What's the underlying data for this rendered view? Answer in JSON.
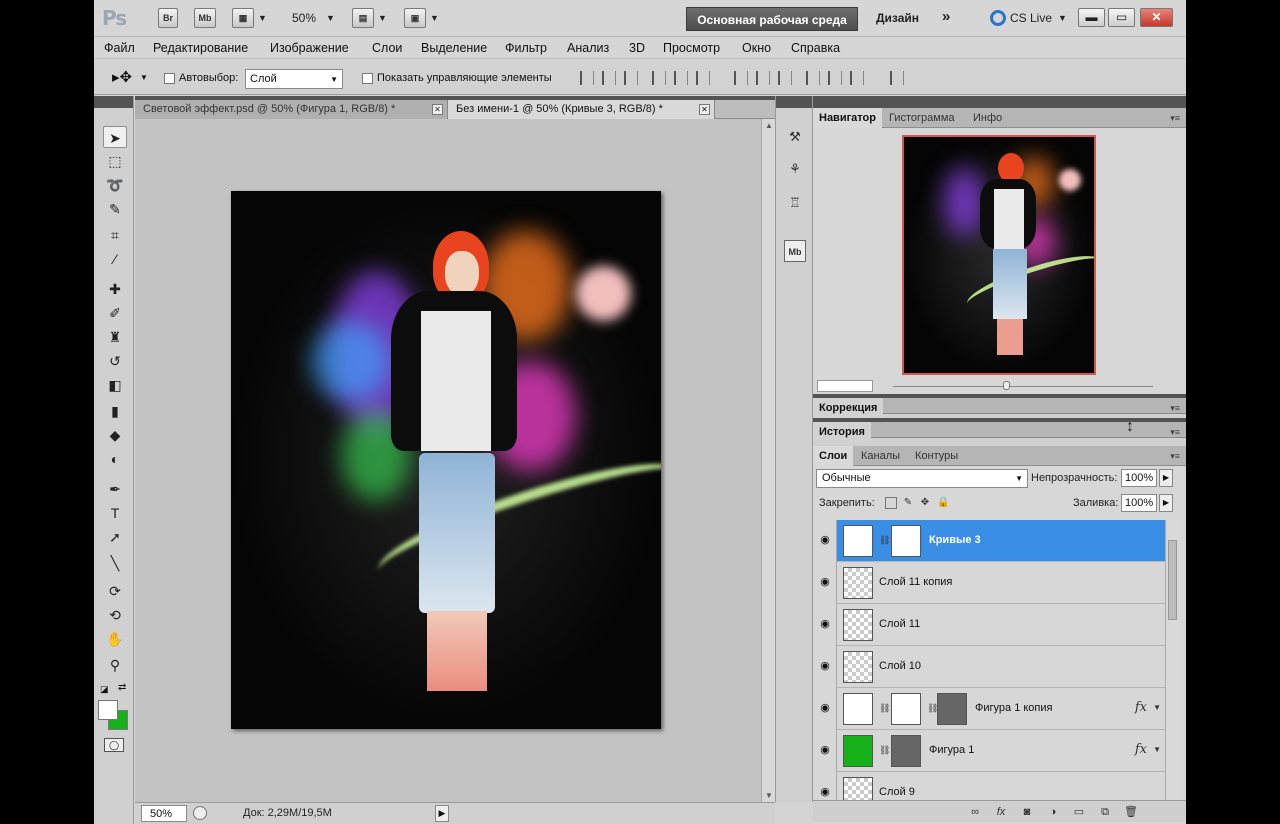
{
  "app": {
    "logo": "Ps",
    "title_icons": [
      "Br",
      "Mb"
    ],
    "zoom_level": "50%",
    "workspace_active": "Основная рабочая среда",
    "workspace_other": "Дизайн",
    "workspace_more": "»",
    "cs_live": "CS Live"
  },
  "menu": [
    "Файл",
    "Редактирование",
    "Изображение",
    "Слои",
    "Выделение",
    "Фильтр",
    "Анализ",
    "3D",
    "Просмотр",
    "Окно",
    "Справка"
  ],
  "options": {
    "autoselect_label": "Автовыбор:",
    "autoselect_value": "Слой",
    "show_controls_label": "Показать управляющие элементы"
  },
  "document_tabs": [
    {
      "label": "Световой эффект.psd @ 50% (Фигура 1, RGB/8) *",
      "active": false
    },
    {
      "label": "Без имени-1 @ 50% (Кривые 3, RGB/8) *",
      "active": true
    }
  ],
  "status": {
    "zoom": "50%",
    "doc_info": "Док: 2,29M/19,5M"
  },
  "navigator_panel": {
    "tabs": [
      "Навигатор",
      "Гистограмма",
      "Инфо"
    ]
  },
  "correction_panel": {
    "title": "Коррекция"
  },
  "history_panel": {
    "title": "История"
  },
  "layers_panel": {
    "tabs": [
      "Слои",
      "Каналы",
      "Контуры"
    ],
    "blend_mode": "Обычные",
    "opacity_label": "Непрозрачность:",
    "opacity_value": "100%",
    "lock_label": "Закрепить:",
    "fill_label": "Заливка:",
    "fill_value": "100%",
    "layers": [
      {
        "name": "Кривые 3",
        "selected": true,
        "kind": "adjustment"
      },
      {
        "name": "Слой 11 копия",
        "selected": false,
        "kind": "transparent"
      },
      {
        "name": "Слой 11",
        "selected": false,
        "kind": "transparent"
      },
      {
        "name": "Слой 10",
        "selected": false,
        "kind": "transparent"
      },
      {
        "name": "Фигура 1 копия",
        "selected": false,
        "kind": "shape-white",
        "fx": "fx"
      },
      {
        "name": "Фигура 1",
        "selected": false,
        "kind": "shape-green",
        "fx": "fx"
      },
      {
        "name": "Слой 9",
        "selected": false,
        "kind": "image"
      }
    ]
  },
  "colors": {
    "foreground": "#ffffff",
    "background": "#17b21a",
    "selection": "#3a8ee6",
    "workspace_button": "#5a5a5a",
    "close_button": "#c43a2e"
  },
  "icons": {
    "toolbox": [
      "move-icon",
      "marquee-icon",
      "lasso-icon",
      "quick-select-icon",
      "crop-icon",
      "eyedropper-icon",
      "healing-icon",
      "brush-icon",
      "stamp-icon",
      "history-brush-icon",
      "eraser-icon",
      "gradient-icon",
      "blur-icon",
      "dodge-icon",
      "pen-icon",
      "type-icon",
      "path-select-icon",
      "line-icon",
      "3d-rotate-icon",
      "3d-orbit-icon",
      "hand-icon",
      "zoom-icon"
    ]
  }
}
